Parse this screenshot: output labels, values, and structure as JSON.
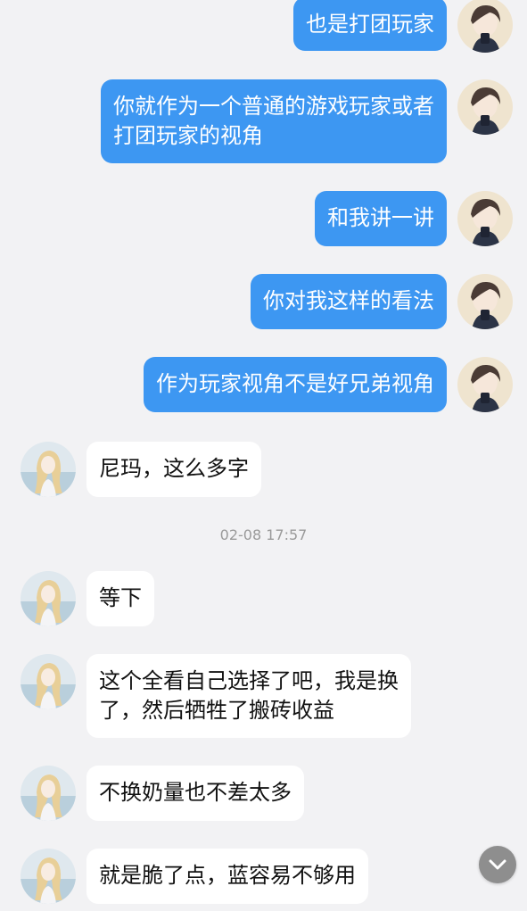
{
  "colors": {
    "background": "#f2f2f4",
    "outgoing_bubble": "#3d97f2",
    "incoming_bubble": "#ffffff",
    "timestamp_text": "#9a9a9a"
  },
  "messages": [
    {
      "side": "out",
      "text": "也是打团玩家"
    },
    {
      "side": "out",
      "text": "你就作为一个普通的游戏玩家或者\n打团玩家的视角"
    },
    {
      "side": "out",
      "text": "和我讲一讲"
    },
    {
      "side": "out",
      "text": "你对我这样的看法"
    },
    {
      "side": "out",
      "text": "作为玩家视角不是好兄弟视角"
    },
    {
      "side": "in",
      "text": "尼玛，这么多字"
    },
    {
      "side": "in",
      "text": "等下"
    },
    {
      "side": "in",
      "text": "这个全看自己选择了吧，我是换\n了，然后牺牲了搬砖收益"
    },
    {
      "side": "in",
      "text": "不换奶量也不差太多"
    },
    {
      "side": "in",
      "text": "就是脆了点，蓝容易不够用"
    }
  ],
  "timestamp": "02-08 17:57",
  "icons": {
    "self_avatar": "avatar-dark-hair-boy",
    "other_avatar": "avatar-blonde-girl",
    "scroll_down": "chevron-down-icon"
  }
}
